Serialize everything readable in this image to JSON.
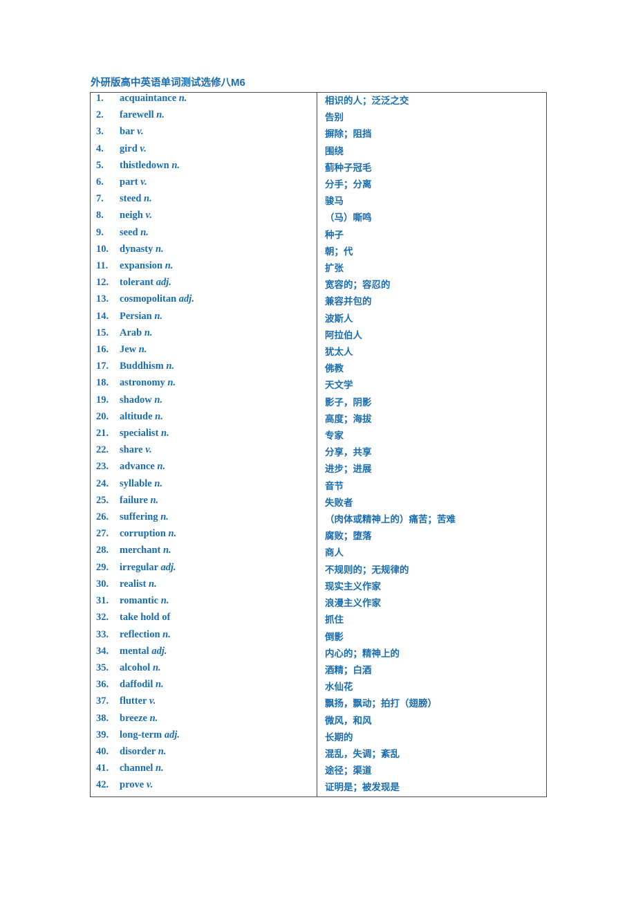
{
  "document": {
    "title_cn": "外研版高中英语单词测试选修八",
    "title_latin": "M6",
    "text_color": "#1a6cb0",
    "border_color": "#4a4a4a",
    "page_background": "#ffffff"
  },
  "vocabulary": {
    "rows": [
      {
        "num": "1.",
        "term": "acquaintance",
        "pos": "n.",
        "meaning": "相识的人；泛泛之交"
      },
      {
        "num": "2.",
        "term": "farewell",
        "pos": "n.",
        "meaning": "告别"
      },
      {
        "num": "3.",
        "term": "bar",
        "pos": "v.",
        "meaning": "摒除；阻挡"
      },
      {
        "num": "4.",
        "term": "gird",
        "pos": "v.",
        "meaning": "围绕"
      },
      {
        "num": "5.",
        "term": "thistledown",
        "pos": "n.",
        "meaning": "蓟种子冠毛"
      },
      {
        "num": "6.",
        "term": "part",
        "pos": "v.",
        "meaning": "分手；分离"
      },
      {
        "num": "7.",
        "term": "steed",
        "pos": "n.",
        "meaning": "骏马"
      },
      {
        "num": "8.",
        "term": "neigh",
        "pos": "v.",
        "meaning": "（马）嘶鸣"
      },
      {
        "num": "9.",
        "term": "seed",
        "pos": "n.",
        "meaning": "种子"
      },
      {
        "num": "10.",
        "term": "dynasty",
        "pos": "n.",
        "meaning": "朝；代"
      },
      {
        "num": "11.",
        "term": "expansion",
        "pos": "n.",
        "meaning": "扩张"
      },
      {
        "num": "12.",
        "term": "tolerant",
        "pos": "adj.",
        "meaning": "宽容的；容忍的"
      },
      {
        "num": "13.",
        "term": "cosmopolitan",
        "pos": "adj.",
        "meaning": "兼容并包的"
      },
      {
        "num": "14.",
        "term": "Persian",
        "pos": "n.",
        "meaning": "波斯人"
      },
      {
        "num": "15.",
        "term": "Arab",
        "pos": "n.",
        "meaning": "阿拉伯人"
      },
      {
        "num": "16.",
        "term": "Jew",
        "pos": "n.",
        "meaning": "犹太人"
      },
      {
        "num": "17.",
        "term": "Buddhism",
        "pos": "n.",
        "meaning": "佛教"
      },
      {
        "num": "18.",
        "term": "astronomy",
        "pos": "n.",
        "meaning": "天文学"
      },
      {
        "num": "19.",
        "term": "shadow",
        "pos": "n.",
        "meaning": "影子，阴影"
      },
      {
        "num": "20.",
        "term": "altitude",
        "pos": "n.",
        "meaning": "高度；海拔"
      },
      {
        "num": "21.",
        "term": "specialist",
        "pos": "n.",
        "meaning": "专家"
      },
      {
        "num": "22.",
        "term": "share",
        "pos": "v.",
        "meaning": "分享，共享"
      },
      {
        "num": "23.",
        "term": "advance",
        "pos": "n.",
        "meaning": "进步；进展"
      },
      {
        "num": "24.",
        "term": "syllable",
        "pos": "n.",
        "meaning": "音节"
      },
      {
        "num": "25.",
        "term": "failure",
        "pos": "n.",
        "meaning": "失败者"
      },
      {
        "num": "26.",
        "term": "suffering",
        "pos": "n.",
        "meaning": "（肉体或精神上的）痛苦；苦难"
      },
      {
        "num": "27.",
        "term": "corruption",
        "pos": "n.",
        "meaning": "腐败；堕落"
      },
      {
        "num": "28.",
        "term": "merchant",
        "pos": "n.",
        "meaning": "商人"
      },
      {
        "num": "29.",
        "term": "irregular",
        "pos": "adj.",
        "meaning": "不规则的；无规律的"
      },
      {
        "num": "30.",
        "term": "realist",
        "pos": "n.",
        "meaning": "现实主义作家"
      },
      {
        "num": "31.",
        "term": "romantic",
        "pos": "n.",
        "meaning": "浪漫主义作家"
      },
      {
        "num": "32.",
        "term": "take hold of",
        "pos": "",
        "meaning": "抓住"
      },
      {
        "num": "33.",
        "term": "reflection",
        "pos": "n.",
        "meaning": "倒影"
      },
      {
        "num": "34.",
        "term": "mental",
        "pos": "adj.",
        "meaning": "内心的；精神上的"
      },
      {
        "num": "35.",
        "term": "alcohol",
        "pos": "n.",
        "meaning": "酒精；白酒"
      },
      {
        "num": "36.",
        "term": "daffodil",
        "pos": "n.",
        "meaning": "水仙花"
      },
      {
        "num": "37.",
        "term": "flutter",
        "pos": "v.",
        "meaning": "飘扬，飘动；拍打（翅膀）"
      },
      {
        "num": "38.",
        "term": "breeze",
        "pos": "n.",
        "meaning": "微风，和风"
      },
      {
        "num": "39.",
        "term": "long-term",
        "pos": "adj.",
        "meaning": "长期的"
      },
      {
        "num": "40.",
        "term": "disorder",
        "pos": "n.",
        "meaning": "混乱，失调；紊乱"
      },
      {
        "num": "41.",
        "term": "channel",
        "pos": "n.",
        "meaning": "途径；渠道"
      },
      {
        "num": "42.",
        "term": "prove",
        "pos": "v.",
        "meaning": "证明是；被发现是"
      }
    ]
  }
}
